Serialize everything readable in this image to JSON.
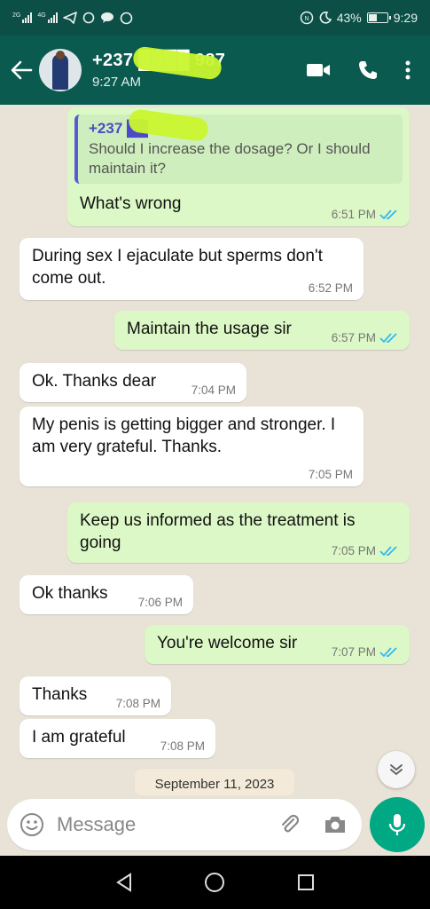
{
  "status_bar": {
    "network_left": "2G",
    "network_right": "4G",
    "battery_percent": "43%",
    "battery_level": 0.43,
    "time": "9:29"
  },
  "header": {
    "contact_name": "+237 ████ 987",
    "last_seen": "9:27 AM",
    "icons": [
      "back-arrow-icon",
      "video-call-icon",
      "voice-call-icon",
      "more-options-icon"
    ]
  },
  "messages": [
    {
      "dir": "out",
      "quote": {
        "name": "+237 ██",
        "text": "Should I increase the dosage? Or I should maintain it?"
      },
      "text": "What's wrong",
      "time": "6:51 PM",
      "read": true
    },
    {
      "dir": "in",
      "text": "During sex I ejaculate but sperms don't come out.",
      "time": "6:52 PM"
    },
    {
      "dir": "out",
      "text": "Maintain the usage sir",
      "time": "6:57 PM",
      "read": true
    },
    {
      "dir": "in",
      "text": "Ok. Thanks dear",
      "time": "7:04 PM"
    },
    {
      "dir": "in",
      "text": "My penis is getting bigger and stronger. I am very grateful. Thanks.",
      "time": "7:05 PM"
    },
    {
      "dir": "out",
      "text": "Keep us informed as the treatment is going",
      "time": "7:05 PM",
      "read": true
    },
    {
      "dir": "in",
      "text": "Ok thanks",
      "time": "7:06 PM"
    },
    {
      "dir": "out",
      "text": "You're welcome sir",
      "time": "7:07 PM",
      "read": true
    },
    {
      "dir": "in",
      "text": "Thanks",
      "time": "7:08 PM"
    },
    {
      "dir": "in",
      "text": "I am grateful",
      "time": "7:08 PM"
    }
  ],
  "date_chip": "September 11, 2023",
  "composer": {
    "placeholder": "Message"
  },
  "colors": {
    "header": "#0b5a50",
    "outgoing": "#dcf8c6",
    "incoming": "#ffffff",
    "mic": "#00a884",
    "read_ticks": "#34b7f1"
  }
}
